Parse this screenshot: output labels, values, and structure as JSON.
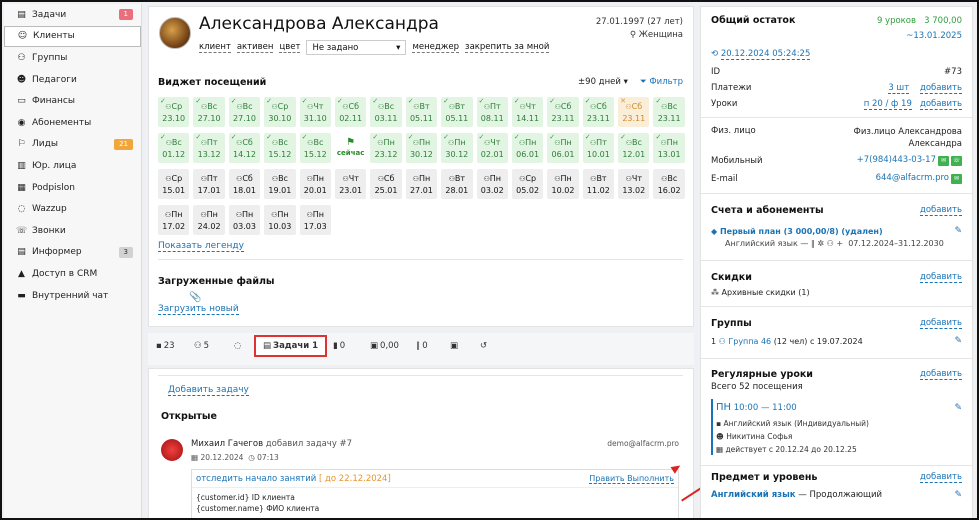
{
  "sidebar": {
    "items": [
      {
        "icon": "clipboard-icon",
        "label": "Задачи",
        "badge": "1",
        "badge_color": "red"
      },
      {
        "icon": "user-icon",
        "label": "Клиенты",
        "active": true
      },
      {
        "icon": "users-icon",
        "label": "Группы"
      },
      {
        "icon": "teacher-icon",
        "label": "Педагоги"
      },
      {
        "icon": "money-icon",
        "label": "Финансы"
      },
      {
        "icon": "ticket-icon",
        "label": "Абонементы"
      },
      {
        "icon": "lead-icon",
        "label": "Лиды",
        "badge": "21",
        "badge_color": "orange"
      },
      {
        "icon": "building-icon",
        "label": "Юр. лица"
      },
      {
        "icon": "doc-icon",
        "label": "Podpislon"
      },
      {
        "icon": "whatsapp-icon",
        "label": "Wazzup"
      },
      {
        "icon": "phone-icon",
        "label": "Звонки"
      },
      {
        "icon": "info-icon",
        "label": "Информер",
        "badge": "3",
        "badge_color": "gray"
      },
      {
        "icon": "lock-icon",
        "label": "Доступ в CRM"
      },
      {
        "icon": "chat-icon",
        "label": "Внутренний чат"
      }
    ]
  },
  "client": {
    "name": "Александрова Александра",
    "dob": "27.01.1997 (27 лет)",
    "gender": "Женщина",
    "links": [
      "клиент",
      "активен",
      "цвет"
    ],
    "select_value": "Не задано",
    "manager_link": "менеджер",
    "pin_link": "закрепить за мной"
  },
  "attendance": {
    "title": "Виджет посещений",
    "range": "±90 дней",
    "filter": "Фильтр",
    "legend_link": "Показать легенду",
    "cells": [
      [
        "Ср",
        "23.10",
        "g"
      ],
      [
        "Вс",
        "27.10",
        "g"
      ],
      [
        "Вс",
        "27.10",
        "g"
      ],
      [
        "Ср",
        "30.10",
        "g"
      ],
      [
        "Чт",
        "31.10",
        "g"
      ],
      [
        "Сб",
        "02.11",
        "g"
      ],
      [
        "Вс",
        "03.11",
        "g"
      ],
      [
        "Вт",
        "05.11",
        "g"
      ],
      [
        "Вт",
        "05.11",
        "g"
      ],
      [
        "Пт",
        "08.11",
        "g"
      ],
      [
        "Чт",
        "14.11",
        "g"
      ],
      [
        "Сб",
        "23.11",
        "g"
      ],
      [
        "Сб",
        "23.11",
        "g"
      ],
      [
        "Сб",
        "23.11",
        "o"
      ],
      [
        "Вс",
        "23.11",
        "g"
      ],
      [
        "Вс",
        "01.12",
        "g"
      ],
      [
        "Пт",
        "13.12",
        "g"
      ],
      [
        "Сб",
        "14.12",
        "g"
      ],
      [
        "Вс",
        "15.12",
        "g"
      ],
      [
        "Вс",
        "15.12",
        "g"
      ],
      [
        "",
        "сейчас",
        "now"
      ],
      [
        "Пн",
        "23.12",
        "g"
      ],
      [
        "Пн",
        "30.12",
        "g"
      ],
      [
        "Пн",
        "30.12",
        "g"
      ],
      [
        "Чт",
        "02.01",
        "g"
      ],
      [
        "Пн",
        "06.01",
        "g"
      ],
      [
        "Пн",
        "06.01",
        "g"
      ],
      [
        "Пт",
        "10.01",
        "g"
      ],
      [
        "Вс",
        "12.01",
        "g"
      ],
      [
        "Пн",
        "13.01",
        "g"
      ],
      [
        "Ср",
        "15.01",
        "gry"
      ],
      [
        "Пт",
        "17.01",
        "gry"
      ],
      [
        "Сб",
        "18.01",
        "gry"
      ],
      [
        "Вс",
        "19.01",
        "gry"
      ],
      [
        "Пн",
        "20.01",
        "gry"
      ],
      [
        "Чт",
        "23.01",
        "gry"
      ],
      [
        "Сб",
        "25.01",
        "gry"
      ],
      [
        "Пн",
        "27.01",
        "gry"
      ],
      [
        "Вт",
        "28.01",
        "gry"
      ],
      [
        "Пн",
        "03.02",
        "gry"
      ],
      [
        "Ср",
        "05.02",
        "gry"
      ],
      [
        "Пн",
        "10.02",
        "gry"
      ],
      [
        "Вт",
        "11.02",
        "gry"
      ],
      [
        "Чт",
        "13.02",
        "gry"
      ],
      [
        "Вс",
        "16.02",
        "gry"
      ],
      [
        "Пн",
        "17.02",
        "gry"
      ],
      [
        "Пн",
        "24.02",
        "gry"
      ],
      [
        "Пн",
        "03.03",
        "gry"
      ],
      [
        "Пн",
        "10.03",
        "gry"
      ],
      [
        "Пн",
        "17.03",
        "gry"
      ]
    ]
  },
  "files": {
    "title": "Загруженные файлы",
    "upload": "Загрузить новый"
  },
  "tabs": [
    {
      "icon": "comment-icon",
      "label": "23"
    },
    {
      "icon": "users-icon",
      "label": "5"
    },
    {
      "icon": "whatsapp-icon",
      "label": ""
    },
    {
      "icon": "clipboard-icon",
      "label": "Задачи 1",
      "selected": true
    },
    {
      "icon": "chart-icon",
      "label": "0"
    },
    {
      "icon": "wallet-icon",
      "label": "0,00"
    },
    {
      "icon": "pause-icon",
      "label": "0"
    },
    {
      "icon": "camera-icon",
      "label": ""
    },
    {
      "icon": "history-icon",
      "label": ""
    }
  ],
  "tasks": {
    "add": "Добавить задачу",
    "open": "Открытые",
    "author": "Михаил Гачегов",
    "action": "добавил задачу #7",
    "email": "demo@alfacrm.pro",
    "date": "20.12.2024",
    "time": "07:13",
    "task_title": "отследить начало занятий",
    "deadline": "[ до 22.12.2024]",
    "edit": "Править",
    "done": "Выполнить",
    "body1": "{customer.id} ID клиента",
    "body2": "{customer.name} ФИО клиента"
  },
  "summary": {
    "title": "Общий остаток",
    "lessons": "9 уроков",
    "amount": "3 700,00",
    "until": "~13.01.2025",
    "updated": "20.12.2024 05:24:25",
    "id_label": "ID",
    "id_value": "#73",
    "pay_label": "Платежи",
    "pay_value": "3 шт",
    "pay_add": "добавить",
    "les_label": "Уроки",
    "les_value": "п 20 / ф 19",
    "les_add": "добавить",
    "person_label": "Физ. лицо",
    "person_value": "Физ.лицо Александрова Александра",
    "mobile_label": "Мобильный",
    "mobile": "+7(984)443-03-17",
    "email_label": "E-mail",
    "email": "644@alfacrm.pro"
  },
  "accounts": {
    "title": "Счета и абонементы",
    "add": "добавить",
    "plan": "Первый план (3 000,00/8) (удален)",
    "plan_sub": "Английский язык — ∥ ✲ ⚇ +",
    "plan_dates": "07.12.2024–31.12.2030"
  },
  "discounts": {
    "title": "Скидки",
    "add": "добавить",
    "archive": "Архивные скидки (1)"
  },
  "groups": {
    "title": "Группы",
    "add": "добавить",
    "count": "1",
    "group": "Группа 46",
    "info": "(12 чел) с 19.07.2024"
  },
  "regular": {
    "title": "Регулярные уроки",
    "add": "добавить",
    "total": "Всего 52 посещения",
    "day": "ПН",
    "time": "10:00 — 11:00",
    "subject": "Английский язык (Индивидуальный)",
    "teacher": "Никитина Софья",
    "period": "действует с 20.12.24 до 20.12.25"
  },
  "level": {
    "title": "Предмет и уровень",
    "add": "добавить",
    "subject": "Английский язык",
    "sep": "—",
    "level": "Продолжающий"
  }
}
